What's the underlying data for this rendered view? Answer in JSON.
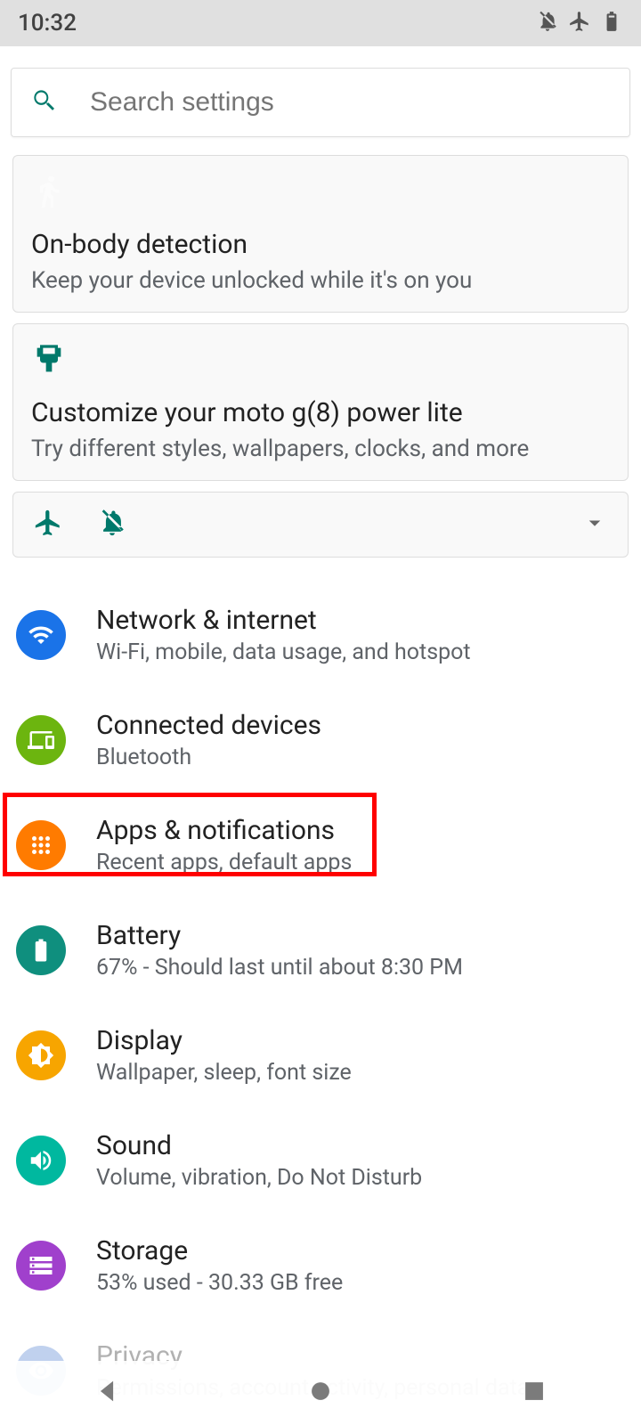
{
  "statusbar": {
    "time": "10:32"
  },
  "search": {
    "placeholder": "Search settings"
  },
  "cards": {
    "onbody": {
      "title": "On-body detection",
      "subtitle": "Keep your device unlocked while it's on you"
    },
    "customize": {
      "title": "Customize your moto g(8) power lite",
      "subtitle": "Try different styles, wallpapers, clocks, and more"
    }
  },
  "items": {
    "network": {
      "title": "Network & internet",
      "subtitle": "Wi-Fi, mobile, data usage, and hotspot",
      "color": "#1a73e8"
    },
    "devices": {
      "title": "Connected devices",
      "subtitle": "Bluetooth",
      "color": "#6cb50f"
    },
    "apps": {
      "title": "Apps & notifications",
      "subtitle": "Recent apps, default apps",
      "color": "#ff7b00"
    },
    "battery": {
      "title": "Battery",
      "subtitle": "67% - Should last until about 8:30 PM",
      "color": "#0f8f7e"
    },
    "display": {
      "title": "Display",
      "subtitle": "Wallpaper, sleep, font size",
      "color": "#f7a500"
    },
    "sound": {
      "title": "Sound",
      "subtitle": "Volume, vibration, Do Not Disturb",
      "color": "#00b89f"
    },
    "storage": {
      "title": "Storage",
      "subtitle": "53% used - 30.33 GB free",
      "color": "#a040cc"
    },
    "privacy": {
      "title": "Privacy",
      "subtitle": "Permissions, account activity, personal data",
      "color": "#4c7ecf"
    }
  }
}
